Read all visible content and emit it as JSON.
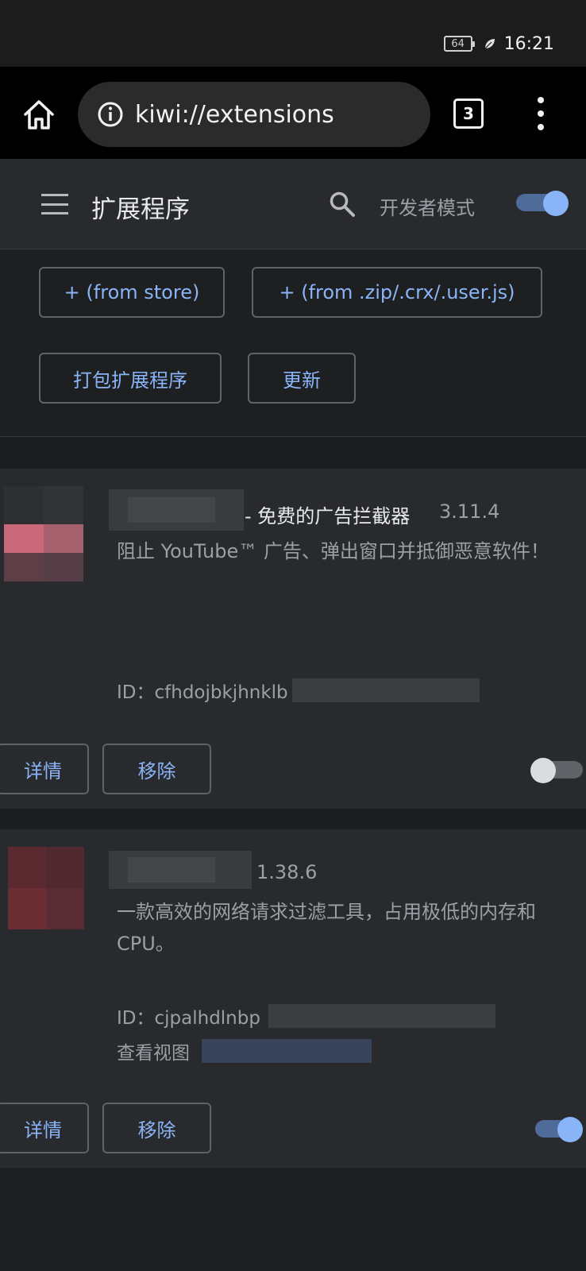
{
  "status": {
    "battery": "64",
    "time": "16:21"
  },
  "browser": {
    "url": "kiwi://extensions",
    "tab_count": "3"
  },
  "header": {
    "title": "扩展程序",
    "dev_mode_label": "开发者模式",
    "dev_mode_on": true
  },
  "actions": {
    "from_store": "+ (from store)",
    "from_file": "+ (from .zip/.crx/.user.js)",
    "pack": "打包扩展程序",
    "update": "更新"
  },
  "extensions": [
    {
      "name_suffix": "- 免费的广告拦截器",
      "version": "3.11.4",
      "description": "阻止 YouTube™ 广告、弹出窗口并抵御恶意软件！",
      "id_label": "ID：",
      "id_visible": "cfhdojbkjhnklb",
      "details": "详情",
      "remove": "移除",
      "enabled": false
    },
    {
      "version": "1.38.6",
      "description": "一款高效的网络请求过滤工具，占用极低的内存和CPU。",
      "id_label": "ID：",
      "id_visible": "cjpalhdlnbp",
      "inspect_label": "查看视图",
      "details": "详情",
      "remove": "移除",
      "enabled": true
    }
  ],
  "colors": {
    "accent": "#8ab4f8",
    "surface": "#292a2d",
    "background": "#1e1f21"
  }
}
